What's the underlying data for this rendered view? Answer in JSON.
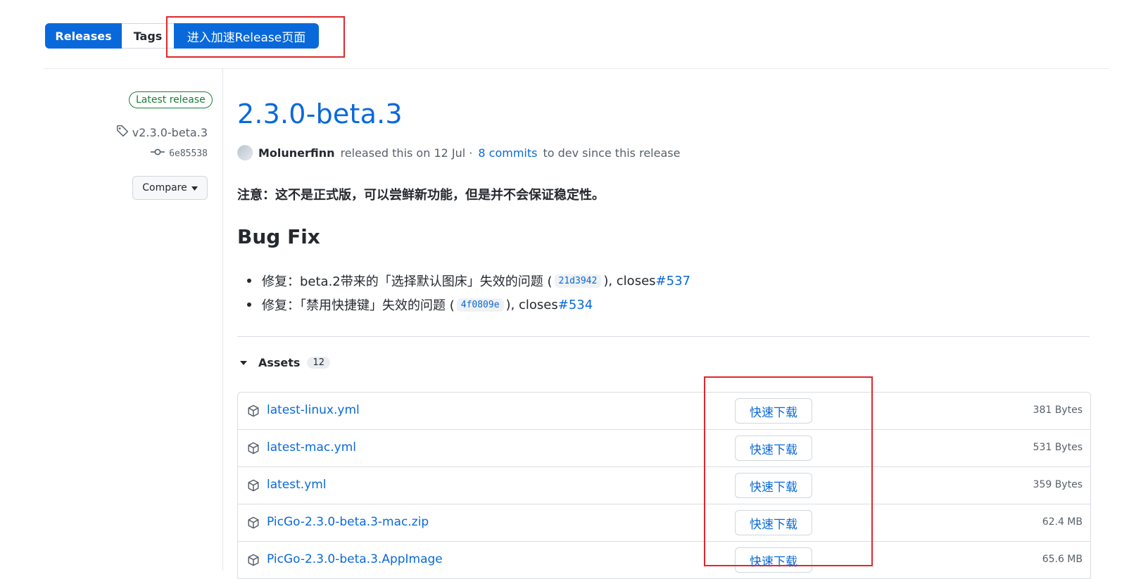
{
  "tabs": {
    "releases": "Releases",
    "tags": "Tags",
    "accelerate": "进入加速Release页面"
  },
  "sidebar": {
    "badge": "Latest release",
    "tag": "v2.3.0-beta.3",
    "commit": "6e85538",
    "compare": "Compare"
  },
  "release": {
    "title": "2.3.0-beta.3",
    "author": "Molunerfinn",
    "released_text": "released this on 12 Jul ·",
    "commits_link": "8 commits",
    "to_dev_text": "to dev since this release",
    "notice": "注意：这不是正式版，可以尝鲜新功能，但是并不会保证稳定性。",
    "section_heading": "Bug Fix",
    "fixes": [
      {
        "prefix": "修复：beta.2带来的「选择默认图床」失效的问题 (",
        "sha": "21d3942",
        "closes": "), closes ",
        "issue": "#537"
      },
      {
        "prefix": "修复：「禁用快捷键」失效的问题 (",
        "sha": "4f0809e",
        "closes": "), closes ",
        "issue": "#534"
      }
    ]
  },
  "assets": {
    "label": "Assets",
    "count": "12",
    "download_label": "快速下载",
    "rows": [
      {
        "name": "latest-linux.yml",
        "size": "381 Bytes"
      },
      {
        "name": "latest-mac.yml",
        "size": "531 Bytes"
      },
      {
        "name": "latest.yml",
        "size": "359 Bytes"
      },
      {
        "name": "PicGo-2.3.0-beta.3-mac.zip",
        "size": "62.4 MB"
      },
      {
        "name": "PicGo-2.3.0-beta.3.AppImage",
        "size": "65.6 MB"
      }
    ]
  },
  "colors": {
    "accent": "#0969da",
    "highlight_box": "#e0272c",
    "latest_badge": "#1a7f37"
  }
}
